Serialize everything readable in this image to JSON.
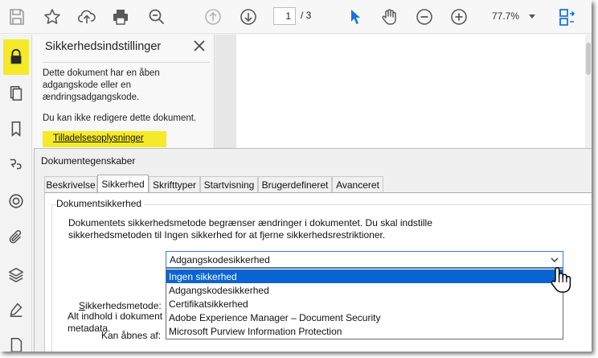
{
  "toolbar": {
    "page_current": "1",
    "page_total": "/ 3",
    "zoom": "77.7%",
    "icons": [
      "save-icon",
      "bookmark-star-icon",
      "cloud-upload-icon",
      "print-icon",
      "zoom-search-icon",
      "page-up-icon",
      "page-down-icon",
      "select-pointer-icon",
      "hand-icon",
      "zoom-out-icon",
      "zoom-in-icon",
      "view-mode-icon"
    ]
  },
  "rail": {
    "icons": [
      "lock-icon",
      "pages-icon",
      "bookmark-icon",
      "attachments-link-icon",
      "content-icon",
      "paperclip-icon",
      "layers-icon",
      "sign-pen-icon",
      "document-icon"
    ]
  },
  "panel": {
    "title": "Sikkerhedsindstillinger",
    "text1": "Dette dokument har en åben adgangskode eller en ændringsadgangskode.",
    "text2": "Du kan ikke redigere dette dokument.",
    "permissions_link": "Tilladelsesoplysninger"
  },
  "dialog": {
    "title": "Dokumentegenskaber",
    "tabs": [
      {
        "label": "Beskrivelse"
      },
      {
        "label": "Sikkerhed"
      },
      {
        "label": "Skrifttyper"
      },
      {
        "label": "Startvisning"
      },
      {
        "label": "Brugerdefineret"
      },
      {
        "label": "Avanceret"
      }
    ],
    "group_label": "Dokumentsikkerhed",
    "description": "Dokumentets sikkerhedsmetode begrænser ændringer i dokumentet. Du skal indstille sikkerhedsmetoden til Ingen sikkerhed for at fjerne sikkerhedsrestriktioner.",
    "method_label_underlined": "S",
    "method_label_rest": "ikkerhedsmetode:",
    "open_label": "Kan åbnes af:",
    "content_label": "Alt indhold i dokument metadata.",
    "select_value": "Adgangskodesikkerhed",
    "options": [
      {
        "label": "Ingen sikkerhed",
        "selected": true
      },
      {
        "label": "Adgangskodesikkerhed",
        "selected": false
      },
      {
        "label": "Certifikatsikkerhed",
        "selected": false
      },
      {
        "label": "Adobe Experience Manager – Document Security",
        "selected": false
      },
      {
        "label": "Microsoft Purview Information Protection",
        "selected": false
      }
    ]
  },
  "colors": {
    "highlight": "#f4ea29",
    "accent_blue": "#0a64d2",
    "icon_gray": "#5a5a5a",
    "icon_blue": "#1473e6"
  }
}
